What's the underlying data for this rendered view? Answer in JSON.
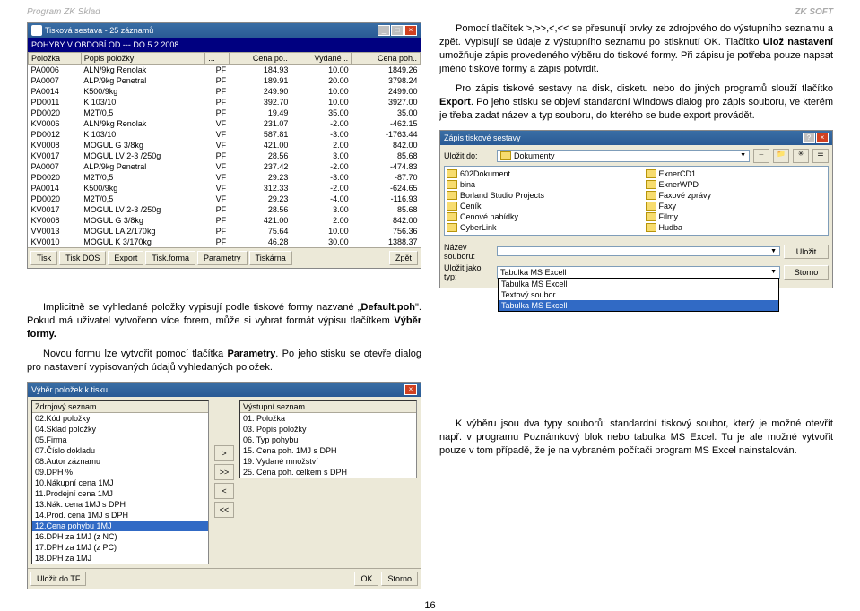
{
  "page_header": {
    "left": "Program ZK Sklad",
    "right": "ZK SOFT"
  },
  "page_number": "16",
  "report_window": {
    "title": "Tisková sestava - 25 záznamů",
    "subtitle": "POHYBY V OBDOBÍ OD --- DO 5.2.2008",
    "columns": [
      "Položka",
      "Popis položky",
      "...",
      "Cena po..",
      "Vydané ..",
      "Cena poh.."
    ],
    "rows": [
      [
        "PA0006",
        "ALN/9kg Renolak",
        "PF",
        "184.93",
        "10.00",
        "1849.26"
      ],
      [
        "PA0007",
        "ALP/9kg Penetral",
        "PF",
        "189.91",
        "20.00",
        "3798.24"
      ],
      [
        "PA0014",
        "K500/9kg",
        "PF",
        "249.90",
        "10.00",
        "2499.00"
      ],
      [
        "PD0011",
        "K 103/10",
        "PF",
        "392.70",
        "10.00",
        "3927.00"
      ],
      [
        "PD0020",
        "M2T/0,5",
        "PF",
        "19.49",
        "35.00",
        "35.00"
      ],
      [
        "KV0006",
        "ALN/9kg Renolak",
        "VF",
        "231.07",
        "-2.00",
        "-462.15"
      ],
      [
        "PD0012",
        "K 103/10",
        "VF",
        "587.81",
        "-3.00",
        "-1763.44"
      ],
      [
        "KV0008",
        "MOGUL G 3/8kg",
        "VF",
        "421.00",
        "2.00",
        "842.00"
      ],
      [
        "KV0017",
        "MOGUL LV 2-3 /250g",
        "PF",
        "28.56",
        "3.00",
        "85.68"
      ],
      [
        "PA0007",
        "ALP/9kg Penetral",
        "VF",
        "237.42",
        "-2.00",
        "-474.83"
      ],
      [
        "PD0020",
        "M2T/0,5",
        "VF",
        "29.23",
        "-3.00",
        "-87.70"
      ],
      [
        "PA0014",
        "K500/9kg",
        "VF",
        "312.33",
        "-2.00",
        "-624.65"
      ],
      [
        "PD0020",
        "M2T/0,5",
        "VF",
        "29.23",
        "-4.00",
        "-116.93"
      ],
      [
        "KV0017",
        "MOGUL LV 2-3 /250g",
        "PF",
        "28.56",
        "3.00",
        "85.68"
      ],
      [
        "KV0008",
        "MOGUL G 3/8kg",
        "PF",
        "421.00",
        "2.00",
        "842.00"
      ],
      [
        "VV0013",
        "MOGUL LA 2/170kg",
        "PF",
        "75.64",
        "10.00",
        "756.36"
      ],
      [
        "KV0010",
        "MOGUL K 3/170kg",
        "PF",
        "46.28",
        "30.00",
        "1388.37"
      ]
    ],
    "buttons": [
      "Tisk",
      "Tisk DOS",
      "Export",
      "Tisk.forma",
      "Parametry",
      "Tiskárna",
      "Zpět"
    ]
  },
  "paragraph1": {
    "p1_a": "Pomocí tlačítek >,>>,<,<< se přesunují prvky ze zdrojového do výstupního seznamu a zpět. Vypisují se údaje z výstupního seznamu po stisknutí OK. Tlačítko ",
    "p1_b": "Ulož nastavení",
    "p1_c": " umožňuje zápis provedeného výběru do tiskové formy. Při zápisu je potřeba pouze napsat jméno tiskové formy a zápis potvrdit.",
    "p2_a": "Pro zápis tiskové sestavy na disk, disketu nebo do jiných programů slouží tlačítko ",
    "p2_b": "Export",
    "p2_c": ". Po jeho stisku se objeví standardní Windows dialog pro zápis souboru, ve kterém je třeba zadat název a typ souboru, do kterého se bude export provádět."
  },
  "save_dialog": {
    "title": "Zápis tiskové sestavy",
    "save_in_label": "Uložit do:",
    "save_in_value": "Dokumenty",
    "folders_left": [
      "602Dokument",
      "bina",
      "Borland Studio Projects",
      "Ceník",
      "Cenové nabídky",
      "CyberLink"
    ],
    "folders_right": [
      "ExnerCD1",
      "ExnerWPD",
      "Faxové zprávy",
      "Faxy",
      "Filmy",
      "Hudba"
    ],
    "filename_label": "Název souboru:",
    "filename_value": "",
    "type_label": "Uložit jako typ:",
    "type_value": "Tabulka MS Excell",
    "type_options": [
      "Tabulka MS Excell",
      "Textový soubor",
      "Tabulka MS Excell"
    ],
    "btn_save": "Uložit",
    "btn_cancel": "Storno"
  },
  "paragraph2": {
    "p1_a": "Implicitně se vyhledané položky vypisují podle tiskové formy nazvané „",
    "p1_b": "Default.poh",
    "p1_c": "\". Pokud má uživatel vytvořeno více forem, může si vybrat formát výpisu tlačítkem ",
    "p1_d": "Výběr formy.",
    "p2_a": "Novou formu lze vytvořit pomocí tlačítka ",
    "p2_b": "Parametry",
    "p2_c": ". Po jeho stisku se otevře dialog pro nastavení vypisovaných údajů vyhledaných položek.",
    "p3": "K výběru jsou dva typy souborů: standardní tiskový soubor, který je možné otevřít např. v programu Poznámkový blok nebo tabulka MS Excel. Tu je ale možné vytvořit pouze v tom případě, že je na vybraném počítači program MS Excel nainstalován."
  },
  "vyber_dialog": {
    "title": "Výběr položek k tisku",
    "src_header": "Zdrojový seznam",
    "dst_header": "Výstupní seznam",
    "src_items": [
      "02.Kód položky",
      "04.Sklad položky",
      "05.Firma",
      "07.Číslo dokladu",
      "08.Autor záznamu",
      "09.DPH %",
      "10.Nákupní cena 1MJ",
      "11.Prodejní cena 1MJ",
      "13.Nák. cena 1MJ s DPH",
      "14.Prod. cena 1MJ s DPH",
      "16.DPH za 1MJ (z NC)",
      "17.DPH za 1MJ (z PC)",
      "18.DPH za 1MJ"
    ],
    "src_selected": "12.Cena pohybu 1MJ",
    "dst_items": [
      "01. Položka",
      "03. Popis položky",
      "06. Typ pohybu",
      "15. Cena poh. 1MJ s DPH",
      "19. Vydané množství",
      "25. Cena poh. celkem s DPH"
    ],
    "arrows": [
      ">",
      ">>",
      "<",
      "<<"
    ],
    "buttons": [
      "Uložit do TF",
      "OK",
      "Storno"
    ]
  }
}
